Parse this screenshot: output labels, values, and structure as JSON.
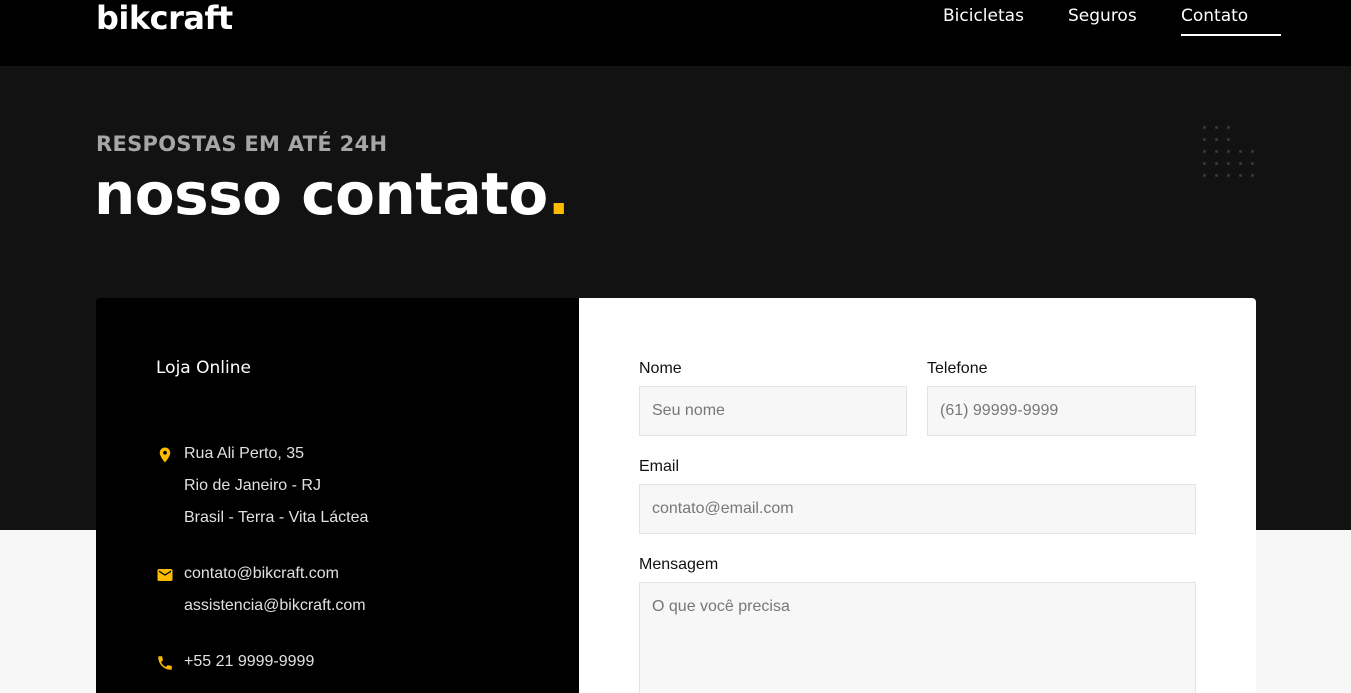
{
  "header": {
    "logo": "bikcraft",
    "nav": [
      "Bicicletas",
      "Seguros",
      "Contato"
    ],
    "active_nav": "Contato"
  },
  "hero": {
    "subtitle": "RESPOSTAS EM ATÉ 24H",
    "title": "nosso contato",
    "title_dot": "."
  },
  "info": {
    "heading": "Loja Online",
    "address": [
      "Rua Ali Perto, 35",
      "Rio de Janeiro - RJ",
      "Brasil - Terra - Vita Láctea"
    ],
    "emails": [
      "contato@bikcraft.com",
      "assistencia@bikcraft.com"
    ],
    "phone": "+55 21 9999-9999",
    "icons": {
      "address": "location-pin-icon",
      "email": "envelope-icon",
      "phone": "phone-icon"
    }
  },
  "form": {
    "name_label": "Nome",
    "name_placeholder": "Seu nome",
    "phone_label": "Telefone",
    "phone_placeholder": "(61) 99999-9999",
    "email_label": "Email",
    "email_placeholder": "contato@email.com",
    "message_label": "Mensagem",
    "message_placeholder": "O que você precisa"
  },
  "colors": {
    "accent": "#ffbb00",
    "header_bg": "#000000",
    "hero_bg": "#121212",
    "page_bg": "#f7f7f7"
  }
}
